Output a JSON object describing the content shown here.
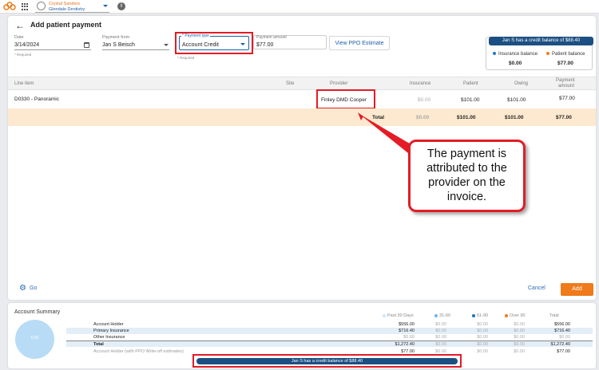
{
  "topbar": {
    "practice_name": "Crystal Sanders",
    "practice_location": "Glendale Dentistry"
  },
  "colors": {
    "accent": "#ef7b1a",
    "primary": "#1c4f82",
    "highlight": "#e31c25",
    "total_row": "#fde9cf"
  },
  "page": {
    "title": "Add patient payment"
  },
  "form": {
    "date_label": "Date",
    "date_value": "3/14/2024",
    "date_required": "* Required",
    "payment_from_label": "Payment from",
    "payment_from_value": "Jan S Beisch",
    "payment_type_label": "* Payment type",
    "payment_type_value": "Account Credit",
    "payment_type_required": "* Required",
    "payment_amount_label": "Payment amount",
    "payment_amount_value": "$77.00",
    "ppo_button": "View PPO Estimate"
  },
  "balance": {
    "banner": "Jan S has a credit balance of $88.40",
    "insurance_label": "Insurance balance",
    "insurance_value": "$0.00",
    "patient_label": "Patient balance",
    "patient_value": "$77.00"
  },
  "table": {
    "headers": {
      "line_item": "Line item",
      "site": "Site",
      "provider": "Provider",
      "insurance": "Insurance",
      "patient": "Patient",
      "owing": "Owing",
      "payment_amount_1": "Payment",
      "payment_amount_2": "amount"
    },
    "row": {
      "line_item": "D0330 - Panoramic",
      "provider": "Finley DMD Cooper",
      "insurance": "$0.00",
      "patient": "$101.00",
      "owing": "$101.00",
      "payment_amount": "$77.00"
    },
    "total": {
      "label": "Total",
      "insurance": "$0.00",
      "patient": "$101.00",
      "owing": "$101.00",
      "payment_amount": "$77.00"
    }
  },
  "footer": {
    "go_label": "Go",
    "cancel_label": "Cancel",
    "add_label": "Add"
  },
  "callout": {
    "line1": "The payment is",
    "line2": "attributed to the",
    "line3": "provider on the",
    "line4": "invoice."
  },
  "summary": {
    "title": "Account Summary",
    "pie_label": "0.00",
    "headers": [
      "Past 30 Days",
      "31-60",
      "61-90",
      "Over 90",
      "Total"
    ],
    "rows": [
      {
        "label": "Account Holder",
        "values": [
          "$556.00",
          "$0.00",
          "$0.00",
          "$0.00",
          "$556.00"
        ]
      },
      {
        "label": "Primary Insurance",
        "values": [
          "$716.40",
          "$0.00",
          "$0.00",
          "$0.00",
          "$716.40"
        ]
      },
      {
        "label": "Other Insurance",
        "values": [
          "$0.00",
          "$0.00",
          "$0.00",
          "$0.00",
          "$0.00"
        ]
      },
      {
        "label": "Total",
        "values": [
          "$1,272.40",
          "$0.00",
          "$0.00",
          "$0.00",
          "$1,272.40"
        ]
      },
      {
        "label": "Account Holder (with PPO Write-off estimates)",
        "values": [
          "$77.00",
          "$0.00",
          "$0.00",
          "$0.00",
          "$77.00"
        ]
      }
    ],
    "credit_banner": "Jan S has a credit balance of $88.40"
  }
}
